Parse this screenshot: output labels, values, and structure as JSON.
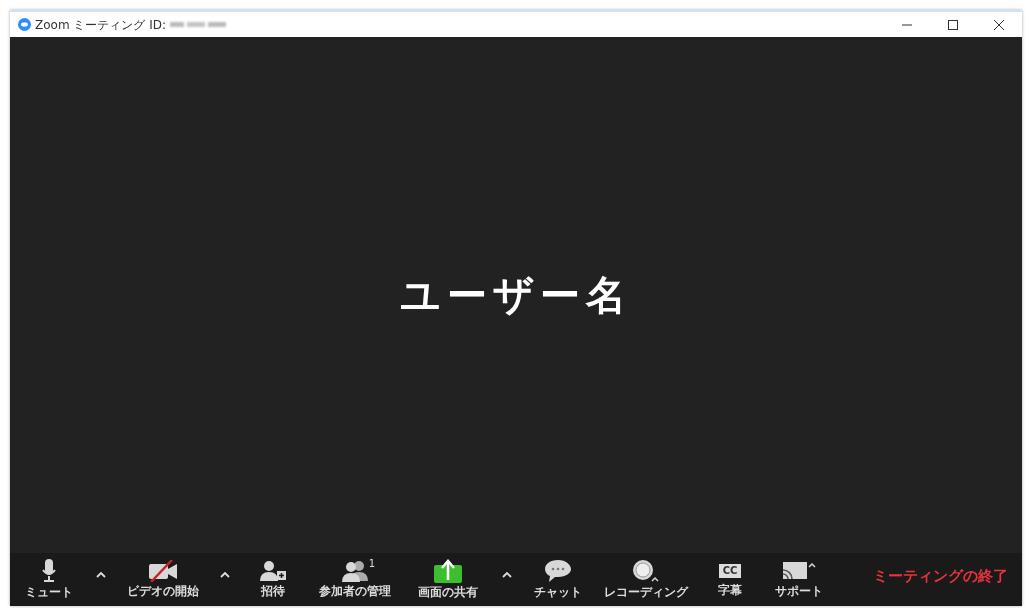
{
  "window": {
    "title": "Zoom ミーティング ID:",
    "id_redacted": true
  },
  "video_area": {
    "participant_name": "ユーザー名"
  },
  "toolbar": [
    {
      "kind": "mic",
      "label": "ミュート"
    },
    {
      "kind": "caret"
    },
    {
      "kind": "video",
      "label": "ビデオの開始",
      "off": true
    },
    {
      "kind": "caret"
    },
    {
      "kind": "invite",
      "label": "招待"
    },
    {
      "kind": "participants",
      "label": "参加者の管理",
      "count": "1"
    },
    {
      "kind": "share",
      "label": "画面の共有"
    },
    {
      "kind": "caret"
    },
    {
      "kind": "chat",
      "label": "チャット"
    },
    {
      "kind": "record",
      "label": "レコーディング"
    },
    {
      "kind": "captions",
      "label": "字幕",
      "badge": "CC"
    },
    {
      "kind": "support",
      "label": "サポート"
    }
  ],
  "end_button": {
    "label": "ミーティングの終了"
  }
}
